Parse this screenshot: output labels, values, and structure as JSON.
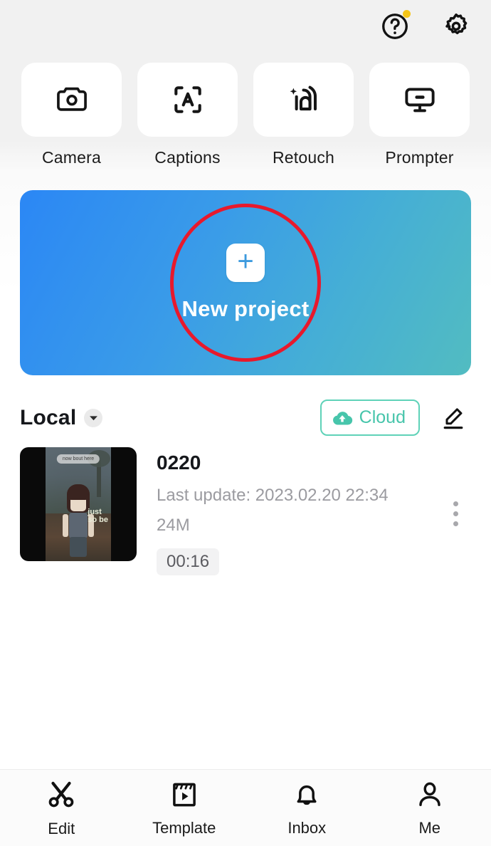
{
  "header": {
    "help_icon": "help-circle-icon",
    "help_badge": "notification-dot",
    "settings_icon": "gear-icon"
  },
  "quick_actions": [
    {
      "label": "Camera",
      "icon": "camera-icon"
    },
    {
      "label": "Captions",
      "icon": "auto-captions-icon"
    },
    {
      "label": "Retouch",
      "icon": "retouch-face-icon"
    },
    {
      "label": "Prompter",
      "icon": "teleprompter-icon"
    }
  ],
  "banner": {
    "label": "New project",
    "plus": "+",
    "gradient_start": "#2b87f5",
    "gradient_end": "#52bcc1",
    "annotation_color": "#e8192c"
  },
  "section": {
    "title": "Local",
    "chevron_icon": "chevron-down-icon",
    "cloud_label": "Cloud",
    "cloud_icon": "cloud-upload-icon",
    "cloud_color": "#47c5ab",
    "edit_icon": "pencil-edit-icon"
  },
  "projects": [
    {
      "title": "0220",
      "last_update": "Last update: 2023.02.20 22:34",
      "size": "24M",
      "duration": "00:16",
      "menu_icon": "more-vertical-icon",
      "thumb_caption": "now bout here",
      "thumb_sticker_line1": "just",
      "thumb_sticker_line2": "so be"
    }
  ],
  "bottom_nav": [
    {
      "label": "Edit",
      "icon": "scissors-icon"
    },
    {
      "label": "Template",
      "icon": "clapperboard-play-icon"
    },
    {
      "label": "Inbox",
      "icon": "bell-icon"
    },
    {
      "label": "Me",
      "icon": "person-icon"
    }
  ]
}
